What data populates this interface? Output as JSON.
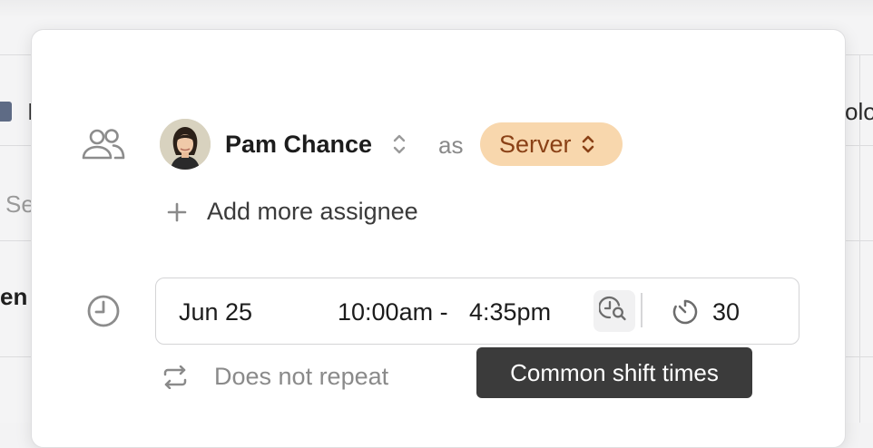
{
  "background": {
    "fragments": {
      "left_search": "Se",
      "left_name": "en",
      "right_header": "olo",
      "left_header": "I"
    }
  },
  "shift_editor": {
    "assignee": {
      "name": "Pam Chance",
      "avatar": "avatar-photo",
      "as_label": "as",
      "role": "Server",
      "role_color": "#f8d7ad",
      "role_text_color": "#8a4116"
    },
    "add_assignee_label": "Add more assignee",
    "time": {
      "date": "Jun 25",
      "start": "10:00am -",
      "end": "4:35pm",
      "break_minutes": "30"
    },
    "repeat_label": "Does not repeat",
    "tooltip": "Common shift times"
  }
}
